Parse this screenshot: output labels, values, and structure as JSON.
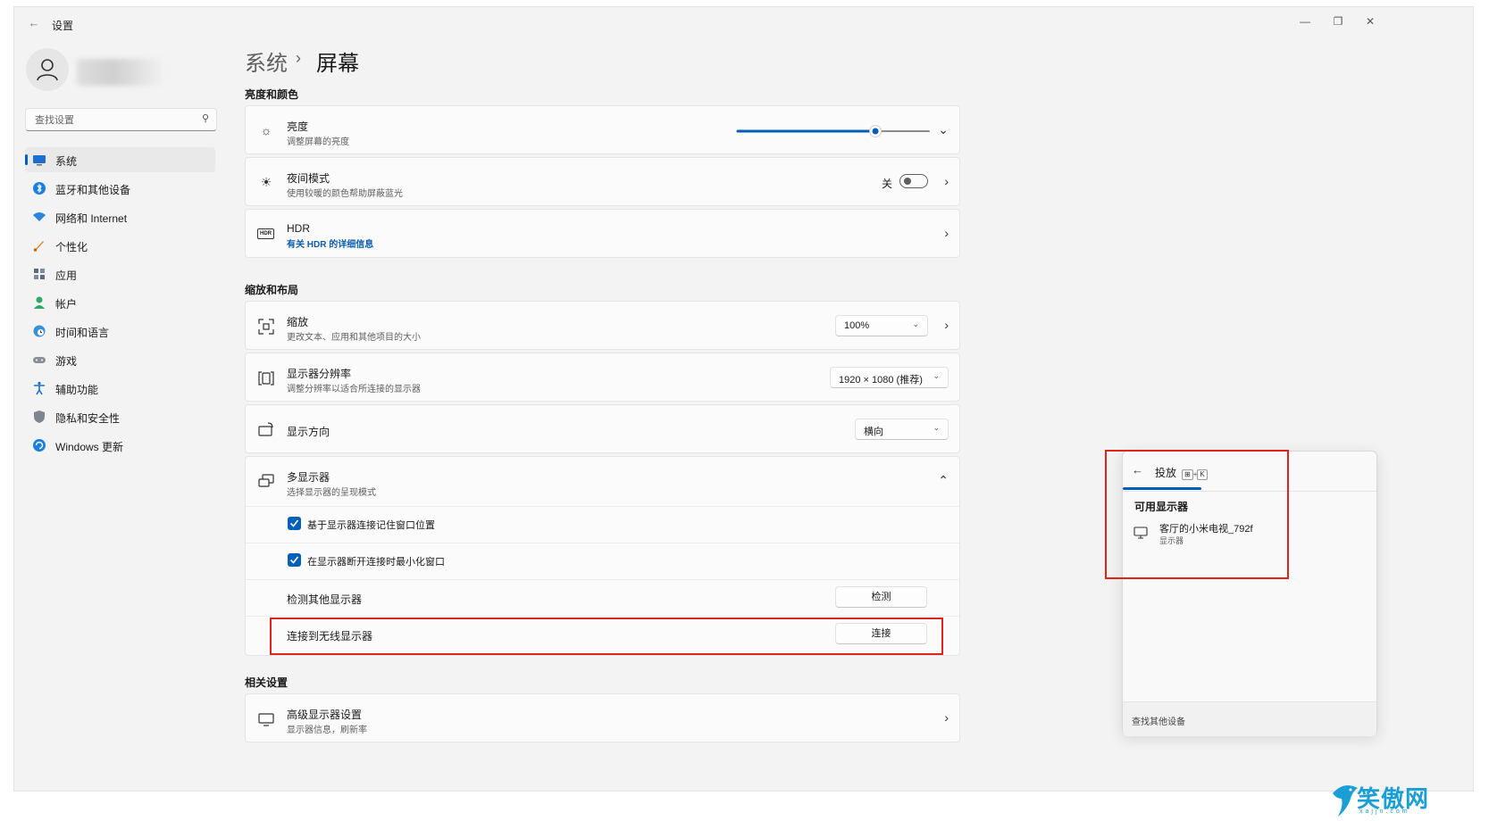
{
  "window": {
    "title": "设置",
    "back_glyph": "←",
    "minimize_glyph": "—",
    "restore_glyph": "❐",
    "close_glyph": "✕"
  },
  "sidebar": {
    "search_placeholder": "查找设置",
    "items": [
      {
        "label": "系统",
        "icon": "system-display-icon",
        "active": true
      },
      {
        "label": "蓝牙和其他设备",
        "icon": "bluetooth-icon"
      },
      {
        "label": "网络和 Internet",
        "icon": "wifi-icon"
      },
      {
        "label": "个性化",
        "icon": "brush-icon"
      },
      {
        "label": "应用",
        "icon": "apps-icon"
      },
      {
        "label": "帐户",
        "icon": "account-icon"
      },
      {
        "label": "时间和语言",
        "icon": "globe-clock-icon"
      },
      {
        "label": "游戏",
        "icon": "gamepad-icon"
      },
      {
        "label": "辅助功能",
        "icon": "accessibility-icon"
      },
      {
        "label": "隐私和安全性",
        "icon": "shield-icon"
      },
      {
        "label": "Windows 更新",
        "icon": "windows-update-icon"
      }
    ]
  },
  "breadcrumb": {
    "parent": "系统",
    "separator": "›",
    "current": "屏幕"
  },
  "sections": {
    "brightness_color": "亮度和颜色",
    "scale_layout": "缩放和布局",
    "related": "相关设置"
  },
  "brightness": {
    "title": "亮度",
    "subtitle": "调整屏幕的亮度",
    "level": 0.72
  },
  "night_light": {
    "title": "夜间模式",
    "subtitle": "使用较暖的颜色帮助屏蔽蓝光",
    "state_label": "关",
    "on": false
  },
  "hdr": {
    "title": "HDR",
    "link": "有关 HDR 的详细信息",
    "icon_text": "HDR"
  },
  "scale": {
    "title": "缩放",
    "subtitle": "更改文本、应用和其他项目的大小",
    "value": "100%"
  },
  "resolution": {
    "title": "显示器分辨率",
    "subtitle": "调整分辨率以适合所连接的显示器",
    "value": "1920 × 1080 (推荐)"
  },
  "orientation": {
    "title": "显示方向",
    "value": "横向"
  },
  "multi_display": {
    "title": "多显示器",
    "subtitle": "选择显示器的呈现模式",
    "remember_positions": "基于显示器连接记住窗口位置",
    "minimize_on_disconnect": "在显示器断开连接时最小化窗口",
    "detect_label": "检测其他显示器",
    "detect_button": "检测",
    "connect_label": "连接到无线显示器",
    "connect_button": "连接"
  },
  "advanced": {
    "title": "高级显示器设置",
    "subtitle": "显示器信息，刷新率"
  },
  "cast_panel": {
    "title": "投放",
    "shortcut_key1": "⊞",
    "shortcut_plus": "+",
    "shortcut_key2": "K",
    "section": "可用显示器",
    "device_name": "客厅的小米电视_792f",
    "device_type": "显示器",
    "footer": "查找其他设备"
  },
  "watermark": {
    "text": "笑傲网",
    "sub": "xajjn.com"
  },
  "colors": {
    "accent": "#005fb8",
    "highlight": "#e0241a"
  }
}
